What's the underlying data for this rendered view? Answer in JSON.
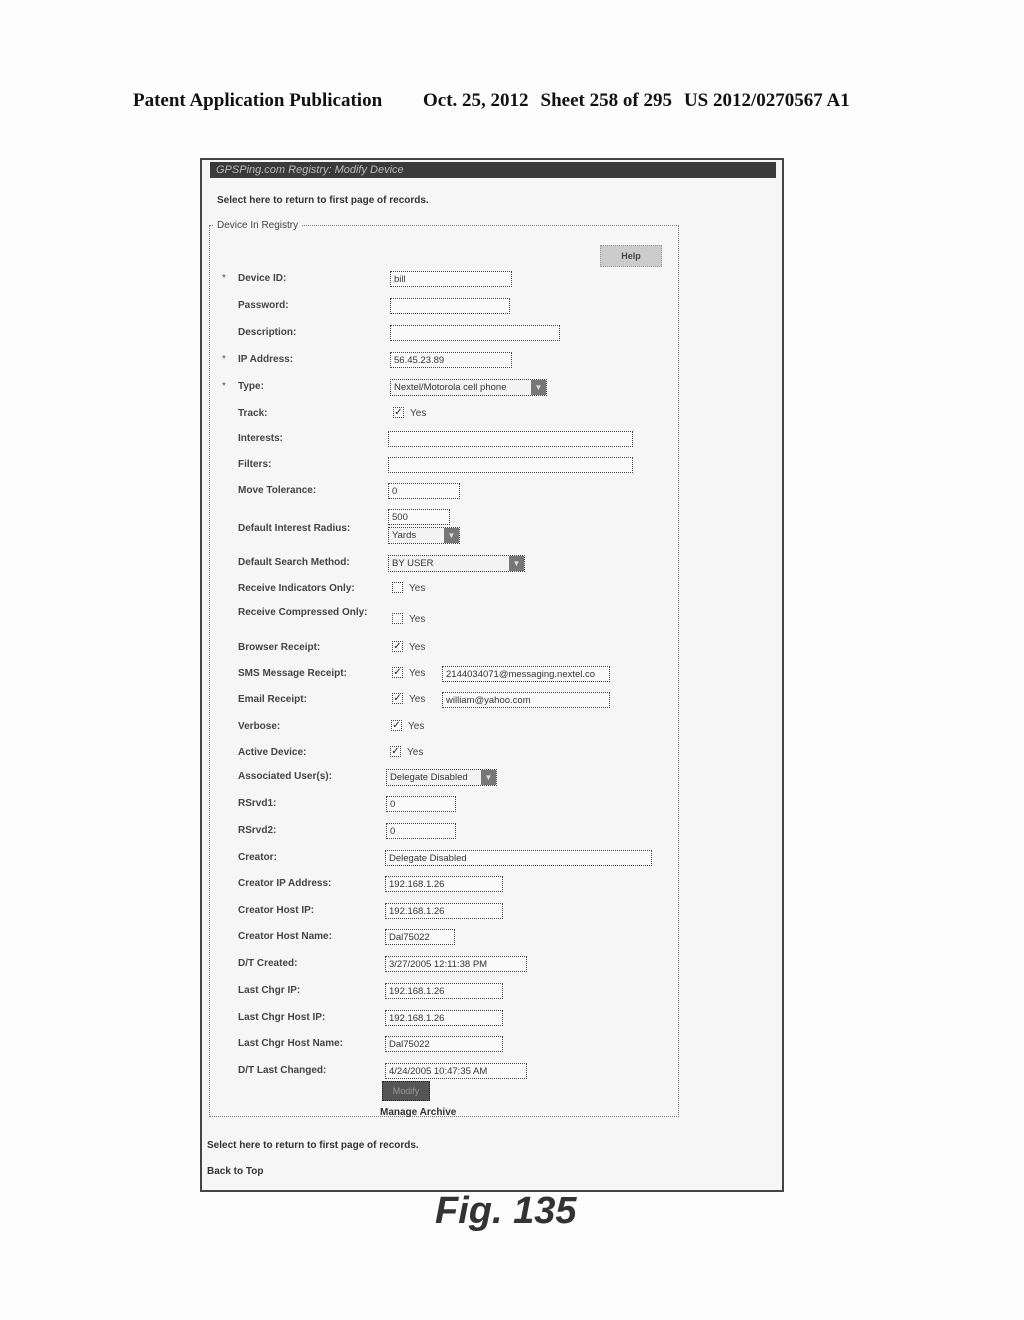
{
  "patent_header": {
    "publication": "Patent Application Publication",
    "date": "Oct. 25, 2012",
    "sheet": "Sheet 258 of 295",
    "number": "US 2012/0270567 A1"
  },
  "window": {
    "title": "GPSPing.com Registry: Modify Device",
    "return_link_top": "Select here to return to first page of records.",
    "fieldset_legend": "Device In Registry",
    "help_label": "Help",
    "submit_label": "Modify",
    "manage_archive": "Manage Archive",
    "return_link_bottom": "Select here to return to first page of records.",
    "back_to_top": "Back to Top"
  },
  "yes_label": "Yes",
  "fields": {
    "device_id": {
      "label": "Device ID:",
      "required": "*",
      "value": "bill"
    },
    "password": {
      "label": "Password:",
      "value": ""
    },
    "description": {
      "label": "Description:",
      "value": ""
    },
    "ip_address": {
      "label": "IP Address:",
      "required": "*",
      "value": "56.45.23.89"
    },
    "type": {
      "label": "Type:",
      "required": "*",
      "value": "Nextel/Motorola cell phone"
    },
    "track": {
      "label": "Track:",
      "checked": true,
      "mark": "✓"
    },
    "interests": {
      "label": "Interests:",
      "value": ""
    },
    "filters": {
      "label": "Filters:",
      "value": ""
    },
    "move_tolerance": {
      "label": "Move Tolerance:",
      "value": "0"
    },
    "default_interest_radius": {
      "label": "Default Interest Radius:",
      "value": "500",
      "unit": "Yards"
    },
    "default_search_method": {
      "label": "Default Search Method:",
      "value": "BY USER"
    },
    "receive_indicators_only": {
      "label": "Receive Indicators Only:",
      "checked": false,
      "mark": ""
    },
    "receive_compressed_only": {
      "label": "Receive Compressed Only:",
      "checked": false,
      "mark": ""
    },
    "browser_receipt": {
      "label": "Browser Receipt:",
      "checked": true,
      "mark": "✓"
    },
    "sms_message_receipt": {
      "label": "SMS Message Receipt:",
      "checked": true,
      "mark": "✓",
      "value": "2144034071@messaging.nextel.co"
    },
    "email_receipt": {
      "label": "Email Receipt:",
      "checked": true,
      "mark": "✓",
      "value": "william@yahoo.com"
    },
    "verbose": {
      "label": "Verbose:",
      "checked": true,
      "mark": "✓"
    },
    "active_device": {
      "label": "Active Device:",
      "checked": true,
      "mark": "✓"
    },
    "associated_users": {
      "label": "Associated User(s):",
      "value": "Delegate Disabled"
    },
    "rsrvd1": {
      "label": "RSrvd1:",
      "value": "0"
    },
    "rsrvd2": {
      "label": "RSrvd2:",
      "value": "0"
    },
    "creator": {
      "label": "Creator:",
      "value": "Delegate Disabled"
    },
    "creator_ip": {
      "label": "Creator IP Address:",
      "value": "192.168.1.26"
    },
    "creator_host_ip": {
      "label": "Creator Host IP:",
      "value": "192.168.1.26"
    },
    "creator_host_name": {
      "label": "Creator Host Name:",
      "value": "Dal75022"
    },
    "dt_created": {
      "label": "D/T Created:",
      "value": "3/27/2005 12:11:38 PM"
    },
    "last_chgr_ip": {
      "label": "Last Chgr IP:",
      "value": "192.168.1.26"
    },
    "last_chgr_host_ip": {
      "label": "Last Chgr Host IP:",
      "value": "192.168.1.26"
    },
    "last_chgr_host_name": {
      "label": "Last Chgr Host Name:",
      "value": "Dal75022"
    },
    "dt_last_changed": {
      "label": "D/T Last Changed:",
      "value": "4/24/2005 10:47:35 AM"
    }
  },
  "figure_label": "Fig. 135"
}
